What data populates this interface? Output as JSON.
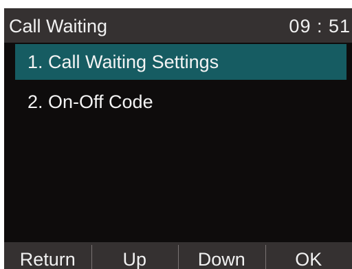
{
  "title_bar": {
    "title": "Call Waiting",
    "time": "09 : 51"
  },
  "menu": {
    "items": [
      {
        "label": "1.  Call Waiting Settings",
        "selected": true
      },
      {
        "label": "2.  On-Off Code",
        "selected": false
      }
    ]
  },
  "softkeys": {
    "return_label": "Return",
    "up_label": "Up",
    "down_label": "Down",
    "ok_label": "OK"
  },
  "colors": {
    "background": "#0e0c0c",
    "bar": "#353131",
    "selection": "#165c62",
    "text": "#f1f1f1"
  }
}
